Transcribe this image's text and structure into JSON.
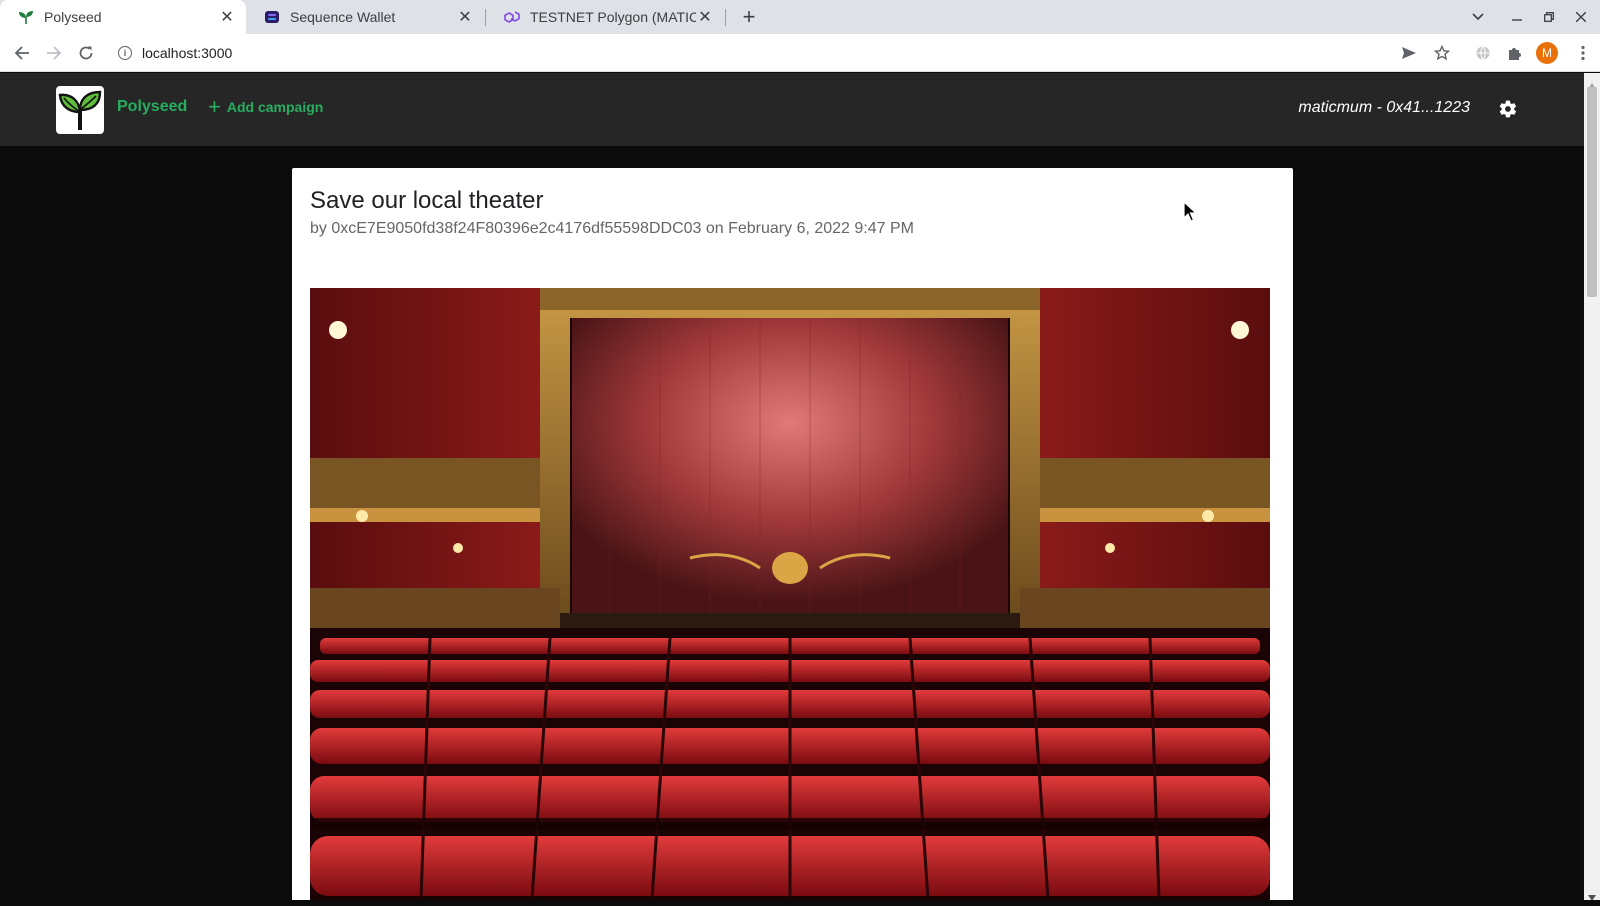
{
  "browser": {
    "tabs": [
      {
        "title": "Polyseed",
        "active": true
      },
      {
        "title": "Sequence Wallet",
        "active": false
      },
      {
        "title": "TESTNET Polygon (MATIC",
        "active": false
      }
    ],
    "url": "localhost:3000",
    "profile_initial": "M"
  },
  "header": {
    "brand": "Polyseed",
    "add_campaign": "Add campaign",
    "account": "maticmum - 0x41...1223"
  },
  "campaign": {
    "title": "Save our local theater",
    "byline": "by 0xcE7E9050fd38f24F80396e2c4176df55598DDC03 on February 6, 2022 9:47 PM"
  },
  "colors": {
    "brand_green": "#27ae60",
    "header_bg": "#262626",
    "page_bg": "#0b0b0b"
  }
}
